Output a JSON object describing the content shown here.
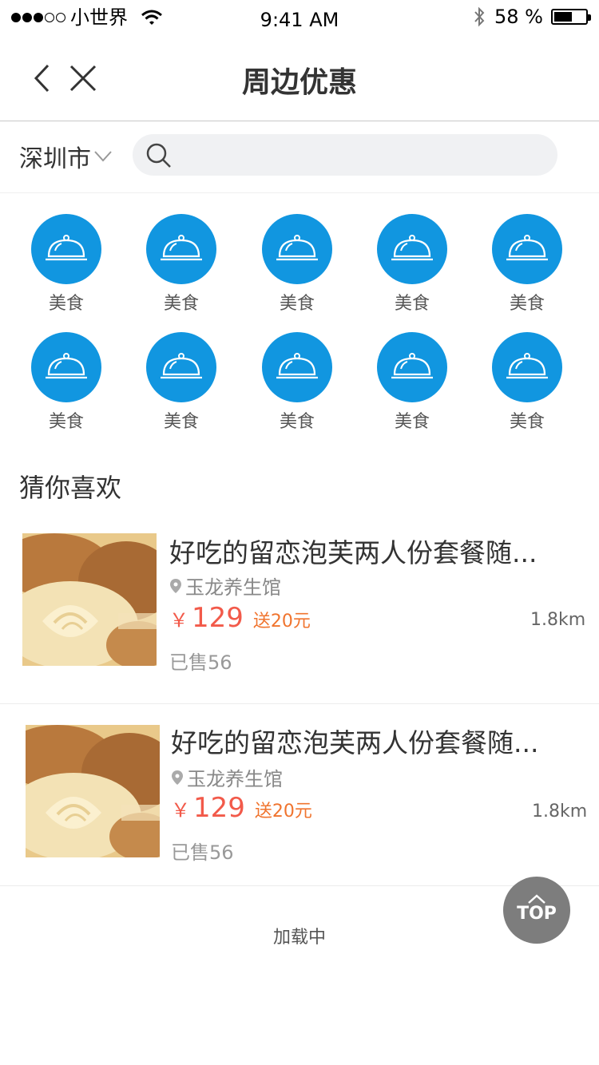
{
  "status_bar": {
    "carrier": "小世界",
    "time": "9:41 AM",
    "battery_percent_text": "58 %",
    "battery_level": 0.58
  },
  "nav": {
    "title": "周边优惠",
    "back_icon": "chevron-left-icon",
    "close_icon": "close-icon"
  },
  "search": {
    "city": "深圳市",
    "placeholder": ""
  },
  "categories": [
    {
      "label": "美食",
      "icon": "food-cloche-icon"
    },
    {
      "label": "美食",
      "icon": "food-cloche-icon"
    },
    {
      "label": "美食",
      "icon": "food-cloche-icon"
    },
    {
      "label": "美食",
      "icon": "food-cloche-icon"
    },
    {
      "label": "美食",
      "icon": "food-cloche-icon"
    },
    {
      "label": "美食",
      "icon": "food-cloche-icon"
    },
    {
      "label": "美食",
      "icon": "food-cloche-icon"
    },
    {
      "label": "美食",
      "icon": "food-cloche-icon"
    },
    {
      "label": "美食",
      "icon": "food-cloche-icon"
    },
    {
      "label": "美食",
      "icon": "food-cloche-icon"
    }
  ],
  "section_title": "猜你喜欢",
  "deals": [
    {
      "title": "好吃的留恋泡芙两人份套餐随...",
      "location": "玉龙养生馆",
      "currency": "￥",
      "price": "129",
      "gift": "送20元",
      "distance": "1.8km",
      "sold": "已售56"
    },
    {
      "title": "好吃的留恋泡芙两人份套餐随...",
      "location": "玉龙养生馆",
      "currency": "￥",
      "price": "129",
      "gift": "送20元",
      "distance": "1.8km",
      "sold": "已售56"
    }
  ],
  "loading_text": "加载中",
  "top_button": "TOP",
  "colors": {
    "category_blue": "#1196e0",
    "price_red": "#f25a4a",
    "gift_orange": "#f0742e",
    "top_button_gray": "#7d7d7d"
  }
}
